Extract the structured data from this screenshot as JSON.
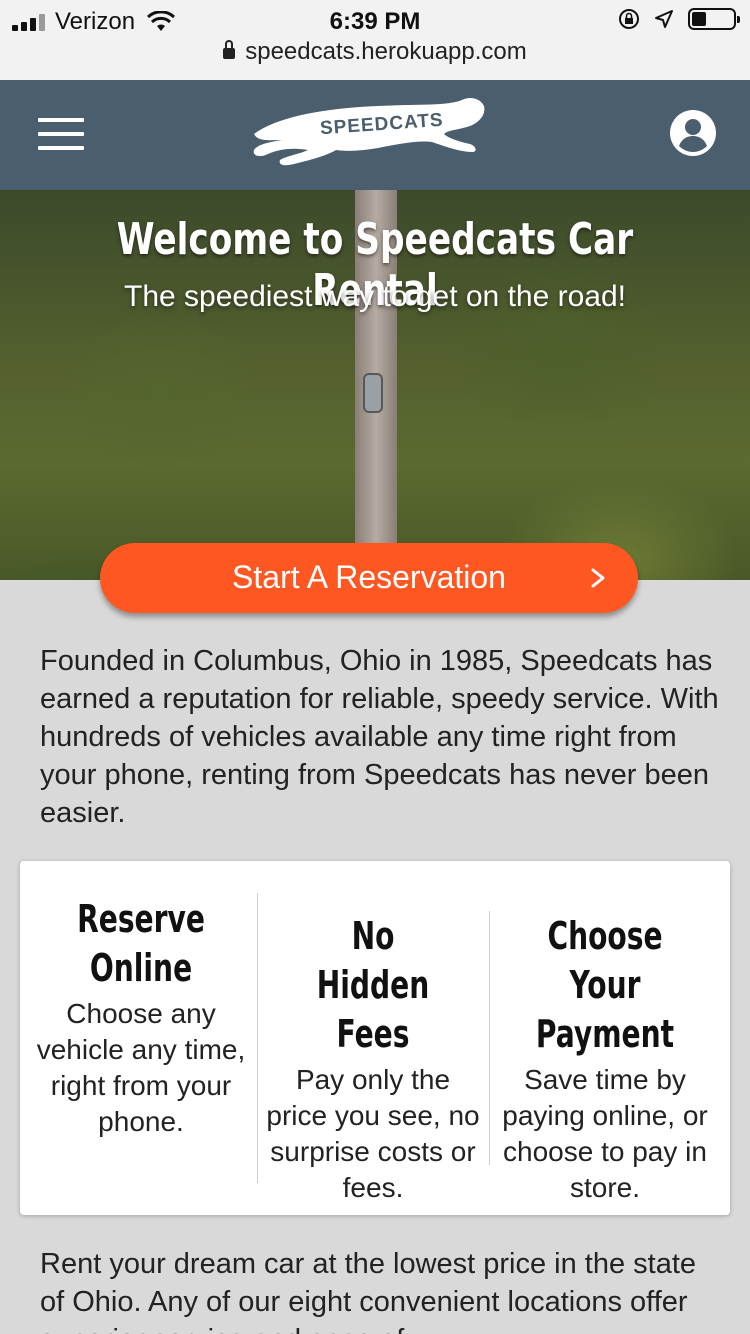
{
  "status_bar": {
    "carrier": "Verizon",
    "time": "6:39 PM",
    "url": "speedcats.herokuapp.com",
    "battery_level": 0.35
  },
  "nav": {
    "logo_text": "SPEEDCATS",
    "menu_icon": "hamburger-menu-icon",
    "account_icon": "account-circle-icon"
  },
  "hero": {
    "title": "Welcome to Speedcats Car Rental",
    "subtitle": "The speediest way to get on the road!"
  },
  "cta": {
    "label": "Start A Reservation",
    "icon": "chevron-right-icon",
    "color": "#ff5722"
  },
  "intro": "Founded in Columbus, Ohio in 1985, Speedcats has earned a reputation for reliable, speedy service. With hundreds of vehicles available any time right from your phone, renting from Speedcats has never been easier.",
  "features": [
    {
      "title": "Reserve Online",
      "desc": "Choose any vehicle any time, right from your phone."
    },
    {
      "title": "No Hidden Fees",
      "desc": "Pay only the price you see, no surprise costs or fees."
    },
    {
      "title": "Choose Your Payment",
      "desc": "Save time by paying online, or choose to pay in store."
    }
  ],
  "rent_text": "Rent your dream car at the lowest price in the state of Ohio. Any of our eight convenient locations offer superior service and ease of",
  "colors": {
    "nav_bg": "#4a5e6d",
    "page_bg": "#d9d9d9",
    "accent": "#ff5722"
  }
}
